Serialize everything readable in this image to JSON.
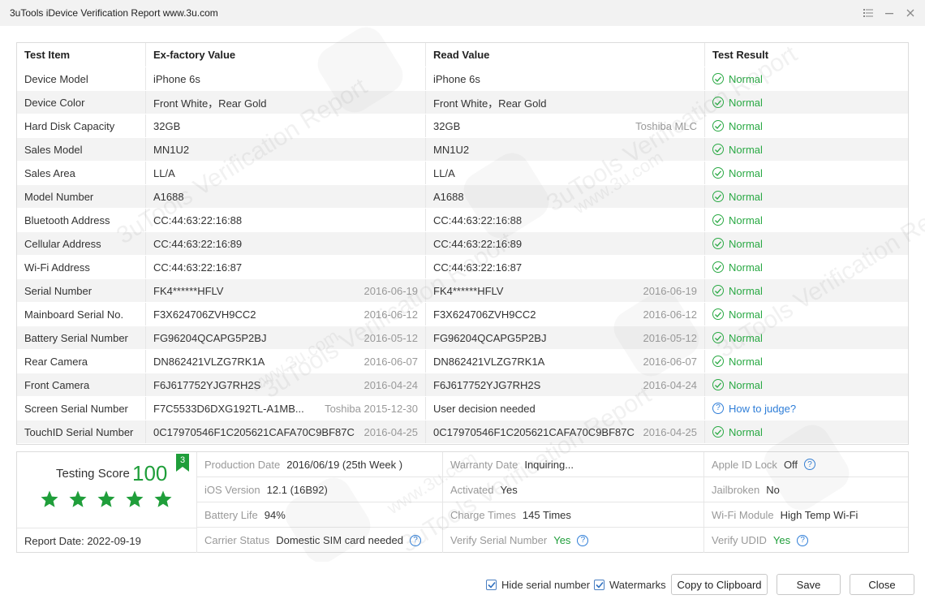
{
  "window": {
    "title": "3uTools iDevice Verification Report www.3u.com"
  },
  "table": {
    "headers": [
      "Test Item",
      "Ex-factory Value",
      "Read Value",
      "Test Result"
    ],
    "rows": [
      {
        "item": "Device Model",
        "ex": "iPhone 6s",
        "ex_note": "",
        "read": "iPhone 6s",
        "read_note": "",
        "result": "Normal",
        "status": "normal"
      },
      {
        "item": "Device Color",
        "ex": "Front White，Rear Gold",
        "ex_note": "",
        "read": "Front White，Rear Gold",
        "read_note": "",
        "result": "Normal",
        "status": "normal"
      },
      {
        "item": "Hard Disk Capacity",
        "ex": "32GB",
        "ex_note": "",
        "read": "32GB",
        "read_note": "Toshiba MLC",
        "result": "Normal",
        "status": "normal"
      },
      {
        "item": "Sales Model",
        "ex": "MN1U2",
        "ex_note": "",
        "read": "MN1U2",
        "read_note": "",
        "result": "Normal",
        "status": "normal"
      },
      {
        "item": "Sales Area",
        "ex": "LL/A",
        "ex_note": "",
        "read": "LL/A",
        "read_note": "",
        "result": "Normal",
        "status": "normal"
      },
      {
        "item": "Model Number",
        "ex": "A1688",
        "ex_note": "",
        "read": "A1688",
        "read_note": "",
        "result": "Normal",
        "status": "normal"
      },
      {
        "item": "Bluetooth Address",
        "ex": "CC:44:63:22:16:88",
        "ex_note": "",
        "read": "CC:44:63:22:16:88",
        "read_note": "",
        "result": "Normal",
        "status": "normal"
      },
      {
        "item": "Cellular Address",
        "ex": "CC:44:63:22:16:89",
        "ex_note": "",
        "read": "CC:44:63:22:16:89",
        "read_note": "",
        "result": "Normal",
        "status": "normal"
      },
      {
        "item": "Wi-Fi Address",
        "ex": "CC:44:63:22:16:87",
        "ex_note": "",
        "read": "CC:44:63:22:16:87",
        "read_note": "",
        "result": "Normal",
        "status": "normal"
      },
      {
        "item": "Serial Number",
        "ex": "FK4******HFLV",
        "ex_note": "2016-06-19",
        "read": "FK4******HFLV",
        "read_note": "2016-06-19",
        "result": "Normal",
        "status": "normal"
      },
      {
        "item": "Mainboard Serial No.",
        "ex": "F3X624706ZVH9CC2",
        "ex_note": "2016-06-12",
        "read": "F3X624706ZVH9CC2",
        "read_note": "2016-06-12",
        "result": "Normal",
        "status": "normal"
      },
      {
        "item": "Battery Serial Number",
        "ex": "FG96204QCAPG5P2BJ",
        "ex_note": "2016-05-12",
        "read": "FG96204QCAPG5P2BJ",
        "read_note": "2016-05-12",
        "result": "Normal",
        "status": "normal"
      },
      {
        "item": "Rear Camera",
        "ex": "DN862421VLZG7RK1A",
        "ex_note": "2016-06-07",
        "read": "DN862421VLZG7RK1A",
        "read_note": "2016-06-07",
        "result": "Normal",
        "status": "normal"
      },
      {
        "item": "Front Camera",
        "ex": "F6J617752YJG7RH2S",
        "ex_note": "2016-04-24",
        "read": "F6J617752YJG7RH2S",
        "read_note": "2016-04-24",
        "result": "Normal",
        "status": "normal"
      },
      {
        "item": "Screen Serial Number",
        "ex": "F7C5533D6DXG192TL-A1MB...",
        "ex_note": "Toshiba 2015-12-30",
        "read": "User decision needed",
        "read_note": "",
        "result": "How to judge?",
        "status": "judge"
      },
      {
        "item": "TouchID Serial Number",
        "ex": "0C17970546F1C205621CAFA70C9BF87C",
        "ex_note": "2016-04-25",
        "read": "0C17970546F1C205621CAFA70C9BF87C",
        "read_note": "2016-04-25",
        "result": "Normal",
        "status": "normal"
      }
    ]
  },
  "summary": {
    "score_label": "Testing Score",
    "score": "100",
    "badge": "3",
    "stars": 5,
    "report_date": "Report Date:  2022-09-19",
    "grid": [
      [
        {
          "label": "Production Date",
          "value": "2016/06/19 (25th Week )",
          "help": false,
          "green": false
        },
        {
          "label": "Warranty Date",
          "value": "Inquiring...",
          "help": false,
          "green": false
        },
        {
          "label": "Apple ID Lock",
          "value": "Off",
          "help": true,
          "green": false
        }
      ],
      [
        {
          "label": "iOS Version",
          "value": "12.1 (16B92)",
          "help": false,
          "green": false
        },
        {
          "label": "Activated",
          "value": "Yes",
          "help": false,
          "green": false
        },
        {
          "label": "Jailbroken",
          "value": "No",
          "help": false,
          "green": false
        }
      ],
      [
        {
          "label": "Battery Life",
          "value": "94%",
          "help": false,
          "green": false
        },
        {
          "label": "Charge Times",
          "value": "145 Times",
          "help": false,
          "green": false
        },
        {
          "label": "Wi-Fi Module",
          "value": "High Temp Wi-Fi",
          "help": false,
          "green": false
        }
      ],
      [
        {
          "label": "Carrier Status",
          "value": "Domestic SIM card needed",
          "help": true,
          "green": false
        },
        {
          "label": "Verify Serial Number",
          "value": "Yes",
          "help": true,
          "green": true
        },
        {
          "label": "Verify UDID",
          "value": "Yes",
          "help": true,
          "green": true
        }
      ]
    ]
  },
  "footer": {
    "hide_serial": {
      "label": "Hide serial number",
      "checked": true
    },
    "watermarks": {
      "label": "Watermarks",
      "checked": true
    },
    "copy": "Copy to Clipboard",
    "save": "Save",
    "close": "Close"
  },
  "watermark": {
    "text": "3uTools Verification Report",
    "site": "www.3u.com"
  },
  "colors": {
    "green": "#1f9e3a",
    "link": "#2f7ed8",
    "row_alt": "#f3f3f3"
  }
}
